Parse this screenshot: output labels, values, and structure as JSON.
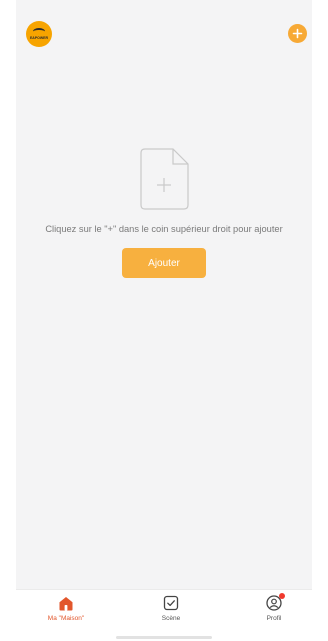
{
  "header": {
    "logo_text": "EAPOWER",
    "add_icon": "plus-circle-icon"
  },
  "empty_state": {
    "icon": "document-add-icon",
    "message": "Cliquez sur le \"+\" dans le coin supérieur droit pour ajouter",
    "button_label": "Ajouter"
  },
  "tabs": [
    {
      "label": "Ma \"Maison\"",
      "icon": "home-icon",
      "active": true
    },
    {
      "label": "Scène",
      "icon": "scene-checkbox-icon",
      "active": false
    },
    {
      "label": "Profil",
      "icon": "profile-icon",
      "active": false,
      "badge": true
    }
  ],
  "colors": {
    "accent": "#f7a935",
    "button": "#f7b03f",
    "active_tab": "#e2562b",
    "badge": "#f03a2e",
    "background": "#f4f4f5"
  }
}
